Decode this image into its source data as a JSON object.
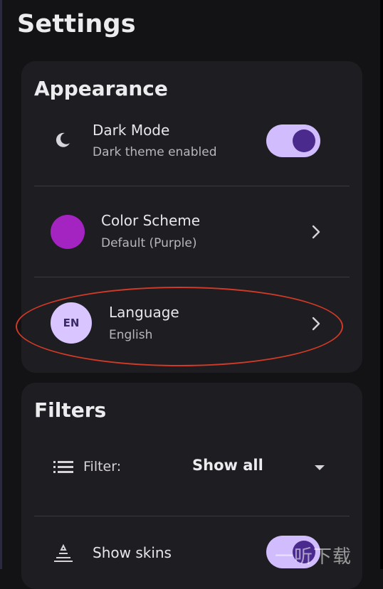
{
  "page": {
    "title": "Settings"
  },
  "appearance": {
    "title": "Appearance",
    "dark_mode": {
      "title": "Dark Mode",
      "subtitle": "Dark theme enabled",
      "enabled": true,
      "icon": "moon-icon"
    },
    "color_scheme": {
      "title": "Color Scheme",
      "subtitle": "Default (Purple)",
      "swatch_color": "#a424c2",
      "icon": "chevron-right-icon"
    },
    "language": {
      "title": "Language",
      "subtitle": "English",
      "badge": "EN",
      "icon": "chevron-right-icon"
    }
  },
  "filters": {
    "title": "Filters",
    "filter": {
      "label": "Filter:",
      "value": "Show all",
      "icon": "list-icon"
    },
    "show_skins": {
      "title": "Show skins",
      "enabled": true,
      "icon": "skins-icon"
    }
  },
  "colors": {
    "accent": "#d1bdfd",
    "thumb": "#4a2a8c",
    "card": "#1e1d21",
    "background": "#131215",
    "highlight": "#d03a26"
  },
  "watermark": {
    "text": "一听下载"
  }
}
